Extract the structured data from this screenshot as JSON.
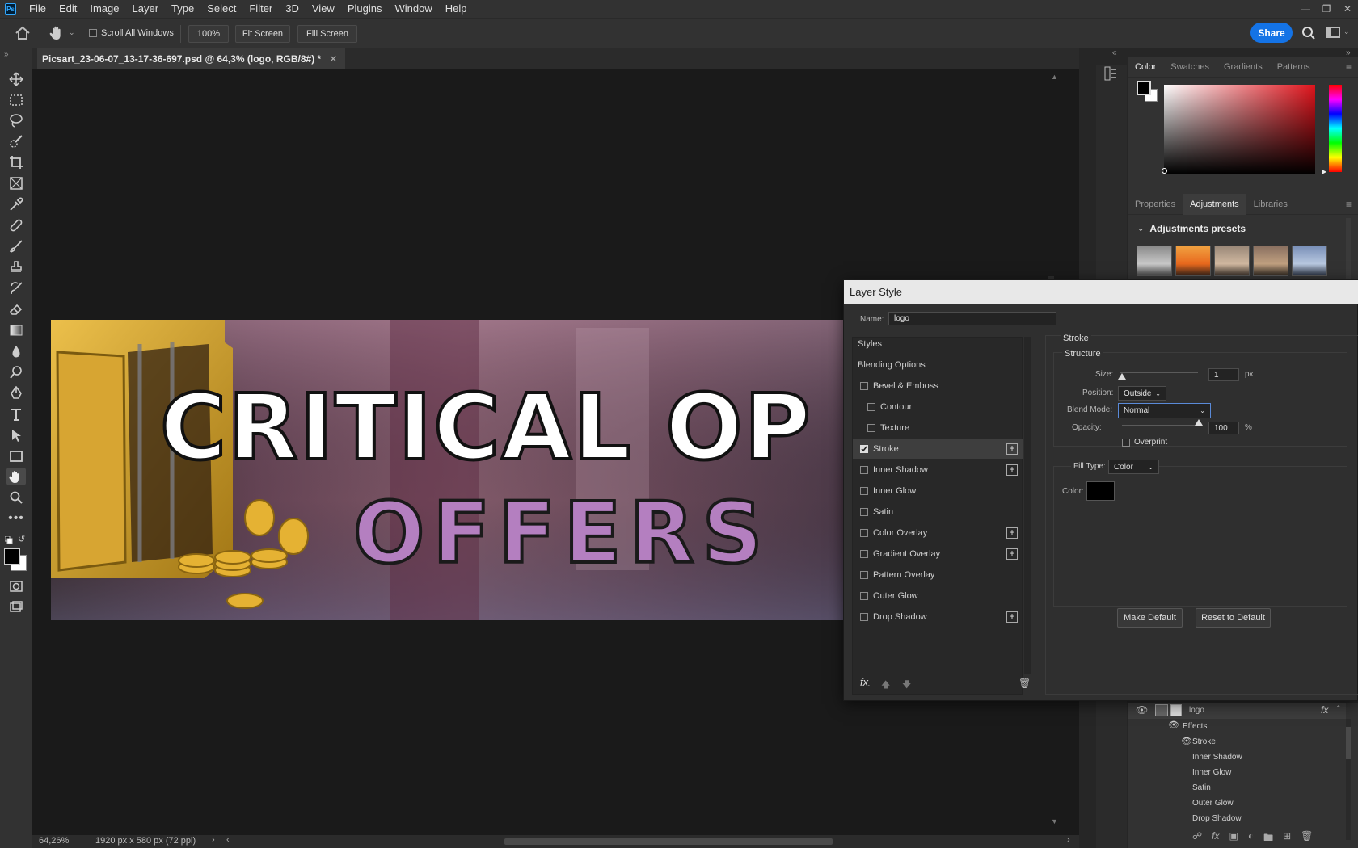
{
  "menubar": {
    "items": [
      "File",
      "Edit",
      "Image",
      "Layer",
      "Type",
      "Select",
      "Filter",
      "3D",
      "View",
      "Plugins",
      "Window",
      "Help"
    ]
  },
  "options": {
    "scroll_all_windows": "Scroll All Windows",
    "zoom_button": "100%",
    "fit_screen": "Fit Screen",
    "fill_screen": "Fill Screen",
    "share": "Share"
  },
  "document": {
    "tab_title": "Picsart_23-06-07_13-17-36-697.psd @ 64,3% (logo, RGB/8#) *",
    "banner_line1": "CRITICAL OP",
    "banner_line2": "OFFERS"
  },
  "status": {
    "zoom": "64,26%",
    "doc_size": "1920 px x 580 px (72 ppi)"
  },
  "color_panel": {
    "tabs": [
      "Color",
      "Swatches",
      "Gradients",
      "Patterns"
    ],
    "active": "Color"
  },
  "adjustments_panel": {
    "tabs": [
      "Properties",
      "Adjustments",
      "Libraries"
    ],
    "active": "Adjustments",
    "section": "Adjustments presets"
  },
  "dialog": {
    "title": "Layer Style",
    "name_label": "Name:",
    "name_value": "logo",
    "styles": [
      {
        "label": "Styles",
        "checkbox": false,
        "plus": false,
        "indent": false,
        "checked": false,
        "selected": false
      },
      {
        "label": "Blending Options",
        "checkbox": false,
        "plus": false,
        "indent": false,
        "checked": false,
        "selected": false
      },
      {
        "label": "Bevel & Emboss",
        "checkbox": true,
        "plus": false,
        "indent": false,
        "checked": false,
        "selected": false
      },
      {
        "label": "Contour",
        "checkbox": true,
        "plus": false,
        "indent": true,
        "checked": false,
        "selected": false
      },
      {
        "label": "Texture",
        "checkbox": true,
        "plus": false,
        "indent": true,
        "checked": false,
        "selected": false
      },
      {
        "label": "Stroke",
        "checkbox": true,
        "plus": true,
        "indent": false,
        "checked": true,
        "selected": true
      },
      {
        "label": "Inner Shadow",
        "checkbox": true,
        "plus": true,
        "indent": false,
        "checked": false,
        "selected": false
      },
      {
        "label": "Inner Glow",
        "checkbox": true,
        "plus": false,
        "indent": false,
        "checked": false,
        "selected": false
      },
      {
        "label": "Satin",
        "checkbox": true,
        "plus": false,
        "indent": false,
        "checked": false,
        "selected": false
      },
      {
        "label": "Color Overlay",
        "checkbox": true,
        "plus": true,
        "indent": false,
        "checked": false,
        "selected": false
      },
      {
        "label": "Gradient Overlay",
        "checkbox": true,
        "plus": true,
        "indent": false,
        "checked": false,
        "selected": false
      },
      {
        "label": "Pattern Overlay",
        "checkbox": true,
        "plus": false,
        "indent": false,
        "checked": false,
        "selected": false
      },
      {
        "label": "Outer Glow",
        "checkbox": true,
        "plus": false,
        "indent": false,
        "checked": false,
        "selected": false
      },
      {
        "label": "Drop Shadow",
        "checkbox": true,
        "plus": true,
        "indent": false,
        "checked": false,
        "selected": false
      }
    ],
    "stroke": {
      "section": "Stroke",
      "structure": "Structure",
      "size_label": "Size:",
      "size_value": "1",
      "size_unit": "px",
      "position_label": "Position:",
      "position_value": "Outside",
      "blend_label": "Blend Mode:",
      "blend_value": "Normal",
      "opacity_label": "Opacity:",
      "opacity_value": "100",
      "opacity_unit": "%",
      "overprint": "Overprint",
      "fill_type_label": "Fill Type:",
      "fill_type_value": "Color",
      "color_label": "Color:",
      "color_value": "#000000"
    },
    "make_default": "Make Default",
    "reset_default": "Reset to Default"
  },
  "layers": {
    "layer_name": "logo",
    "effects_label": "Effects",
    "effects": [
      "Stroke",
      "Inner Shadow",
      "Inner Glow",
      "Satin",
      "Outer Glow",
      "Drop Shadow"
    ]
  },
  "colors": {
    "accent": "#1473e6",
    "foreground": "#000000",
    "background": "#ffffff"
  }
}
